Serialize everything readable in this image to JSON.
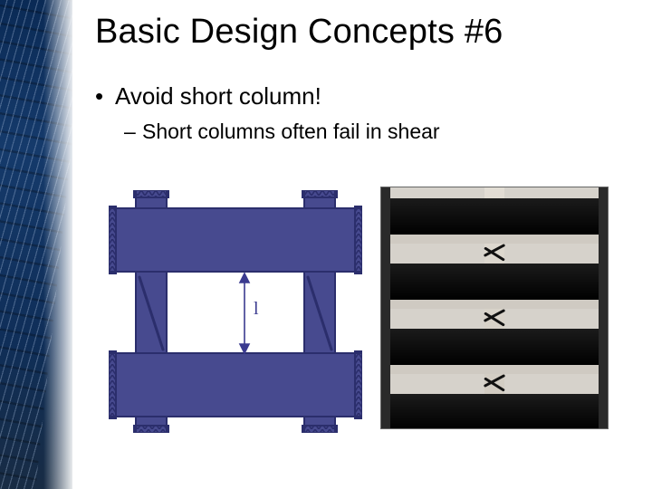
{
  "title": "Basic Design Concepts #6",
  "bullets": {
    "l1": "Avoid short column!",
    "l2": "Short columns often fail in shear"
  },
  "diagram": {
    "dim_label": "l",
    "color_fill": "#474a8f",
    "color_stroke": "#2b2e6c"
  }
}
